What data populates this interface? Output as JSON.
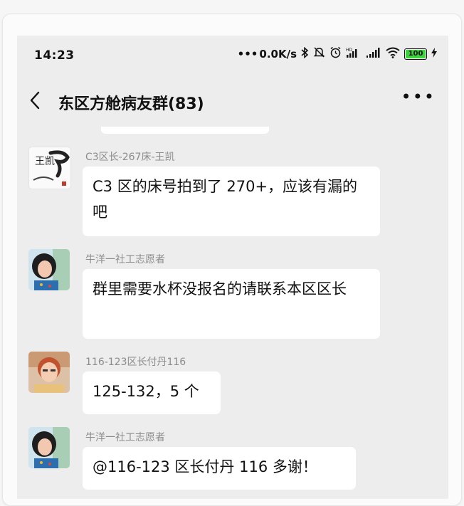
{
  "status": {
    "time": "14:23",
    "speed": "0.0K/s",
    "battery": "100"
  },
  "header": {
    "title": "东区方舱病友群(83)"
  },
  "messages": [
    {
      "sender": "C3区长-267床-王凯",
      "text": "C3 区的床号拍到了 270+，应该有漏的吧",
      "avatar": "calligraphy-avatar"
    },
    {
      "sender": "牛洋一社工志愿者",
      "text": "群里需要水杯没报名的请联系本区区长",
      "avatar": "girl-avatar"
    },
    {
      "sender": "116-123区长付丹116",
      "text": "125-132，5 个",
      "avatar": "woman-avatar"
    },
    {
      "sender": "牛洋一社工志愿者",
      "text": "@116-123 区长付丹 116  多谢！",
      "avatar": "girl-avatar"
    }
  ],
  "avatar_text": {
    "calligraphy": "王凯"
  }
}
